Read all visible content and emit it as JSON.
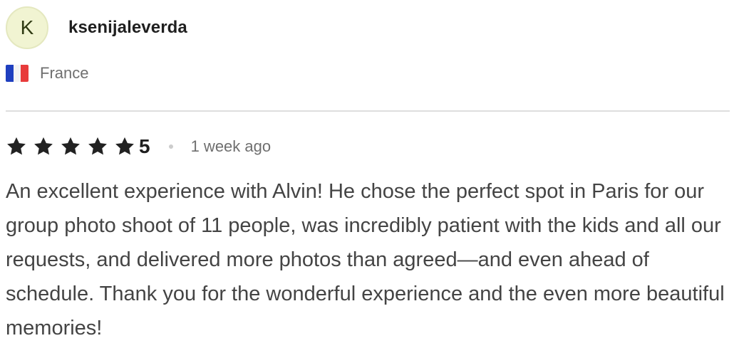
{
  "reviewer": {
    "avatar_initial": "K",
    "name": "ksenijaleverda",
    "country": "France",
    "flag_icon": "france-flag-icon"
  },
  "review": {
    "stars": 5,
    "rating": "5",
    "time_ago": "1 week ago",
    "text": "An excellent experience with Alvin! He chose the perfect spot in Paris for our group photo shoot of 11 people, was incredibly patient with the kids and all our requests, and delivered more photos than agreed—and even ahead of schedule. Thank you for the wonderful experience and the even more beautiful memories!"
  },
  "colors": {
    "avatar_bg": "#f1f4d2",
    "star": "#222222",
    "muted_text": "#6f6f6f",
    "body_text": "#444444"
  }
}
